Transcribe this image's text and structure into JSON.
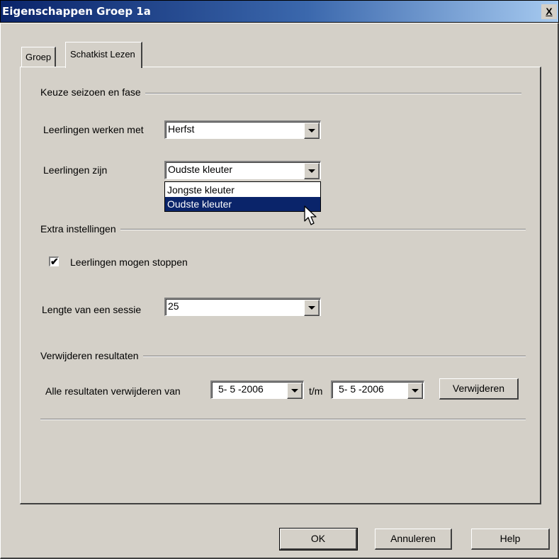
{
  "window": {
    "title": "Eigenschappen Groep 1a",
    "close_label": "X"
  },
  "tabs": [
    {
      "label": "Groep",
      "active": false
    },
    {
      "label": "Schatkist Lezen",
      "active": true
    }
  ],
  "season_group": {
    "title": "Keuze seizoen en fase",
    "work_with_label": "Leerlingen werken met",
    "work_with_value": "Herfst",
    "students_label": "Leerlingen zijn",
    "students_value": "Oudste kleuter",
    "students_options": [
      "Jongste kleuter",
      "Oudste kleuter"
    ],
    "students_options_highlighted": "Oudste kleuter"
  },
  "extra_group": {
    "title": "Extra instellingen",
    "may_stop_label": "Leerlingen mogen stoppen",
    "may_stop_checked": true,
    "session_length_label": "Lengte van een sessie",
    "session_length_value": "25"
  },
  "delete_group": {
    "title": "Verwijderen resultaten",
    "range_label": "Alle resultaten verwijderen van",
    "from_date": "5- 5 -2006",
    "to_label": "t/m",
    "to_date": "5- 5 -2006",
    "delete_button": "Verwijderen"
  },
  "footer": {
    "ok_label": "OK",
    "cancel_label": "Annuleren",
    "help_label": "Help"
  },
  "colors": {
    "dialog_bg": "#d4d0c8",
    "titlebar_start": "#0a246a",
    "titlebar_end": "#a6caf0",
    "selection": "#0a246a"
  }
}
